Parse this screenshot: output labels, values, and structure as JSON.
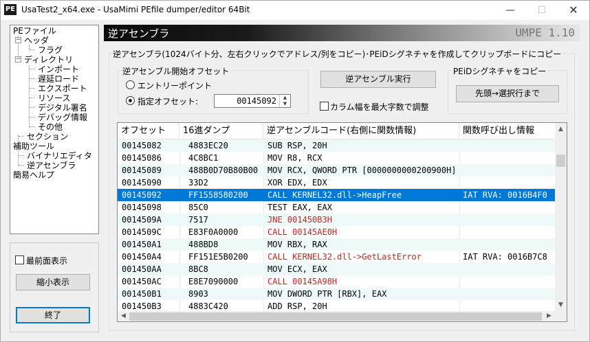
{
  "window": {
    "title": "UsaTest2_x64.exe - UsaMimi PEfile dumper/editor 64Bit",
    "icon_text": "PE"
  },
  "tree": [
    {
      "label": "PEファイル"
    },
    {
      "label": "ヘッダ"
    },
    {
      "label": "フラグ"
    },
    {
      "label": "ディレクトリ"
    },
    {
      "label": "インポート"
    },
    {
      "label": "遅延ロード"
    },
    {
      "label": "エクスポート"
    },
    {
      "label": "リソース"
    },
    {
      "label": "デジタル署名"
    },
    {
      "label": "デバッグ情報"
    },
    {
      "label": "その他"
    },
    {
      "label": "セクション"
    },
    {
      "label": "補助ツール"
    },
    {
      "label": "バイナリエディタ"
    },
    {
      "label": "逆アセンブラ"
    },
    {
      "label": "簡易ヘルプ"
    }
  ],
  "left_panel": {
    "topmost_label": "最前面表示",
    "shrink_label": "縮小表示",
    "exit_label": "終了"
  },
  "banner": {
    "title": "逆アセンブラ",
    "product": "UMPE 1.10"
  },
  "main_group_label": "逆アセンブラ(1024バイト分、左右クリックでアドレス/列をコピー)･PEiDシグネチャを作成してクリップボードにコピー",
  "offset_group": {
    "label": "逆アセンブル開始オフセット",
    "entry_point_label": "エントリーポイント",
    "specified_label": "指定オフセット:",
    "offset_value": "00145092",
    "selected": "specified"
  },
  "run_button_label": "逆アセンブル実行",
  "fit_columns_label": "カラム幅を最大字数で調整",
  "peid_group": {
    "label": "PEiDシグネチャをコピー",
    "button_label": "先頭→選択行まで"
  },
  "table": {
    "columns": [
      "オフセット",
      "16進ダンプ",
      "逆アセンブルコード(右側に関数情報)",
      "関数呼び出し情報"
    ],
    "selected_row": 5,
    "rows": [
      {
        "offset": "00145082",
        "hex": "4883EC20",
        "code": "SUB RSP, 20H",
        "info": "",
        "red": false
      },
      {
        "offset": "00145086",
        "hex": "4C8BC1",
        "code": "MOV R8, RCX",
        "info": "",
        "red": false
      },
      {
        "offset": "00145089",
        "hex": "488B0D70B80B00",
        "code": "MOV RCX, QWORD PTR [0000000000200900H]",
        "info": "",
        "red": false
      },
      {
        "offset": "00145090",
        "hex": "33D2",
        "code": "XOR EDX, EDX",
        "info": "",
        "red": false
      },
      {
        "offset": "00145092",
        "hex": "FF1558580200",
        "code": "CALL KERNEL32.dll->HeapFree",
        "info": "IAT RVA: 0016B4F0",
        "red": false
      },
      {
        "offset": "00145098",
        "hex": "85C0",
        "code": "TEST EAX, EAX",
        "info": "",
        "red": false
      },
      {
        "offset": "0014509A",
        "hex": "7517",
        "code": "JNE 001450B3H",
        "info": "",
        "red": true
      },
      {
        "offset": "0014509C",
        "hex": "E83F0A0000",
        "code": "CALL 00145AE0H",
        "info": "",
        "red": true
      },
      {
        "offset": "001450A1",
        "hex": "488BD8",
        "code": "MOV RBX, RAX",
        "info": "",
        "red": false
      },
      {
        "offset": "001450A4",
        "hex": "FF151E5B0200",
        "code": "CALL KERNEL32.dll->GetLastError",
        "info": "IAT RVA: 0016B7C8",
        "red": true
      },
      {
        "offset": "001450AA",
        "hex": "8BC8",
        "code": "MOV ECX, EAX",
        "info": "",
        "red": false
      },
      {
        "offset": "001450AC",
        "hex": "E8E7090000",
        "code": "CALL 00145A98H",
        "info": "",
        "red": true
      },
      {
        "offset": "001450B1",
        "hex": "8903",
        "code": "MOV DWORD PTR [RBX], EAX",
        "info": "",
        "red": false
      },
      {
        "offset": "001450B3",
        "hex": "4883C420",
        "code": "ADD RSP, 20H",
        "info": "",
        "red": false
      }
    ]
  }
}
